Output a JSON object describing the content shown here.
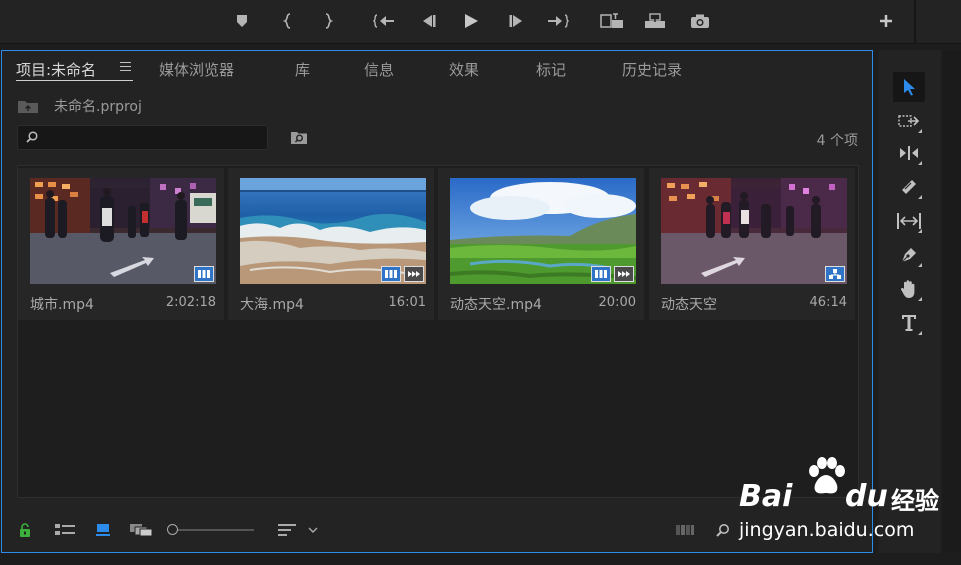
{
  "transport": {
    "buttons": [
      "add-marker",
      "mark-in",
      "mark-out",
      "go-to-in",
      "step-back",
      "play",
      "step-forward",
      "go-to-out",
      "insert",
      "overwrite",
      "export-frame",
      "add"
    ]
  },
  "project_panel": {
    "tabs": [
      {
        "label": "项目:未命名",
        "active": true
      },
      {
        "label": "媒体浏览器"
      },
      {
        "label": "库"
      },
      {
        "label": "信息"
      },
      {
        "label": "效果"
      },
      {
        "label": "标记"
      },
      {
        "label": "历史记录"
      }
    ],
    "project_file": "未命名.prproj",
    "search": {
      "value": "",
      "placeholder": ""
    },
    "item_count": "4 个项",
    "items": [
      {
        "name": "城市.mp4",
        "duration": "2:02:18",
        "thumbnail": "city-night-street",
        "badges": [
          "video"
        ]
      },
      {
        "name": "大海.mp4",
        "duration": "16:01",
        "thumbnail": "ocean-waves",
        "badges": [
          "video",
          "audio"
        ]
      },
      {
        "name": "动态天空.mp4",
        "duration": "20:00",
        "thumbnail": "grassland-sky",
        "badges": [
          "video",
          "audio"
        ]
      },
      {
        "name": "动态天空",
        "duration": "46:14",
        "thumbnail": "city-night-street-pink",
        "badges": [
          "sequence"
        ]
      }
    ]
  },
  "tools": [
    "selection-tool",
    "track-select-tool",
    "ripple-edit-tool",
    "razor-tool",
    "slip-tool",
    "pen-tool",
    "hand-tool",
    "type-tool"
  ],
  "colors": {
    "accent": "#2d8ceb",
    "lock_green": "#3bb13b",
    "badge_blue": "#2f74c7"
  },
  "watermark": {
    "brand_part1": "Bai",
    "brand_part2": "du",
    "brand_cn": "经验",
    "url": "jingyan.baidu.com"
  }
}
